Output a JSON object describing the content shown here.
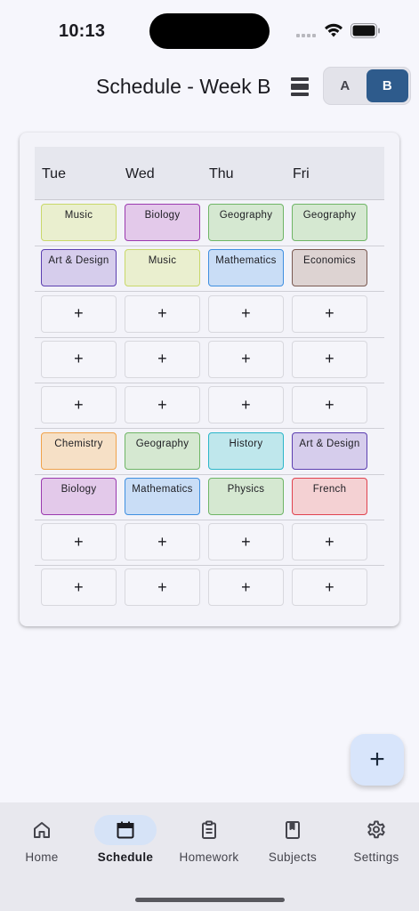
{
  "status_bar": {
    "time": "10:13"
  },
  "header": {
    "title": "Schedule - Week B",
    "week_options": [
      "A",
      "B"
    ],
    "selected_week": "B"
  },
  "schedule": {
    "days": [
      "Tue",
      "Wed",
      "Thu",
      "Fri"
    ],
    "rows": [
      [
        {
          "label": "Music",
          "color": "lime"
        },
        {
          "label": "Biology",
          "color": "purple"
        },
        {
          "label": "Geography",
          "color": "green"
        },
        {
          "label": "Geography",
          "color": "green"
        }
      ],
      [
        {
          "label": "Art & Design",
          "color": "violet"
        },
        {
          "label": "Music",
          "color": "lime"
        },
        {
          "label": "Mathematics",
          "color": "blue"
        },
        {
          "label": "Economics",
          "color": "brown"
        }
      ],
      [
        {
          "label": "+"
        },
        {
          "label": "+"
        },
        {
          "label": "+"
        },
        {
          "label": "+"
        }
      ],
      [
        {
          "label": "+"
        },
        {
          "label": "+"
        },
        {
          "label": "+"
        },
        {
          "label": "+"
        }
      ],
      [
        {
          "label": "+"
        },
        {
          "label": "+"
        },
        {
          "label": "+"
        },
        {
          "label": "+"
        }
      ],
      [
        {
          "label": "Chemistry",
          "color": "orange"
        },
        {
          "label": "Geography",
          "color": "green"
        },
        {
          "label": "History",
          "color": "cyan"
        },
        {
          "label": "Art & Design",
          "color": "violet"
        }
      ],
      [
        {
          "label": "Biology",
          "color": "purple"
        },
        {
          "label": "Mathematics",
          "color": "blue"
        },
        {
          "label": "Physics",
          "color": "green"
        },
        {
          "label": "French",
          "color": "red"
        }
      ],
      [
        {
          "label": "+"
        },
        {
          "label": "+"
        },
        {
          "label": "+"
        },
        {
          "label": "+"
        }
      ],
      [
        {
          "label": "+"
        },
        {
          "label": "+"
        },
        {
          "label": "+"
        },
        {
          "label": "+"
        }
      ]
    ]
  },
  "colors": {
    "lime": {
      "bg": "#eaefcf",
      "border": "#c9d86a"
    },
    "purple": {
      "bg": "#e3c9ea",
      "border": "#9b3aaf"
    },
    "green": {
      "bg": "#d5e8d1",
      "border": "#6fb566"
    },
    "violet": {
      "bg": "#d6cdec",
      "border": "#5c3fb0"
    },
    "blue": {
      "bg": "#c9ddf6",
      "border": "#3f8fe0"
    },
    "brown": {
      "bg": "#ddd3d2",
      "border": "#7a5a52"
    },
    "orange": {
      "bg": "#f6e0c6",
      "border": "#f0a24a"
    },
    "cyan": {
      "bg": "#bfe7ec",
      "border": "#2bb6c9"
    },
    "red": {
      "bg": "#f4d1d3",
      "border": "#e0434f"
    },
    "accent": "#2e5b8c"
  },
  "fab": {
    "label": "+"
  },
  "bottom_nav": {
    "items": [
      {
        "label": "Home",
        "icon": "home-icon"
      },
      {
        "label": "Schedule",
        "icon": "calendar-icon",
        "active": true
      },
      {
        "label": "Homework",
        "icon": "clipboard-icon"
      },
      {
        "label": "Subjects",
        "icon": "book-icon"
      },
      {
        "label": "Settings",
        "icon": "gear-icon"
      }
    ]
  }
}
